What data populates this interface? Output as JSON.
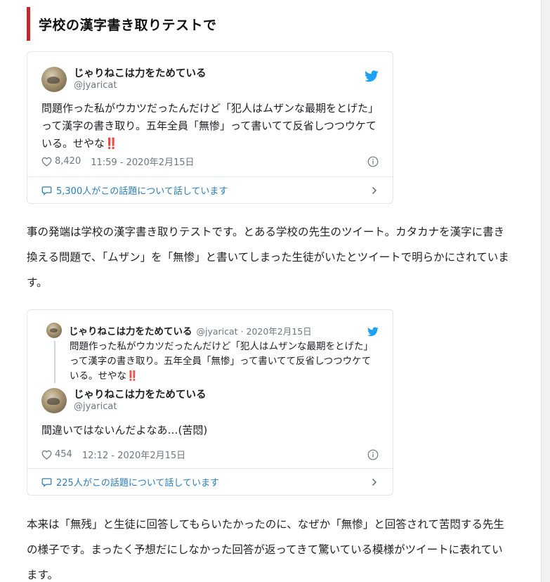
{
  "article": {
    "heading": "学校の漢字書き取りテストで",
    "paragraph1": "事の発端は学校の漢字書き取りテストです。とある学校の先生のツイート。カタカナを漢字に書き換える問題で、「ムザン」を「無惨」と書いてしまった生徒がいたとツイートで明らかにされています。",
    "paragraph2": "本来は「無残」と生徒に回答してもらいたかったのに、なぜか「無惨」と回答されて苦悶する先生の様子です。まったく予想だにしなかった回答が返ってきて驚いている模様がツイートに表れています。"
  },
  "tweet1": {
    "name": "じゃりねこは力をためている",
    "handle": "@jyaricat",
    "text": "問題作った私がウカツだったんだけど「犯人はムザンな最期をとげた」って漢字の書き取り。五年全員「無惨」って書いてて反省しつつウケている。せやな‼️",
    "likes": "8,420",
    "timestamp": "11:59 - 2020年2月15日",
    "replies_label": "5,300人がこの話題について話しています"
  },
  "tweet2": {
    "parent": {
      "name": "じゃりねこは力をためている",
      "handle_date": "@jyaricat · 2020年2月15日",
      "text": "問題作った私がウカツだったんだけど「犯人はムザンな最期をとげた」って漢字の書き取り。五年全員「無惨」って書いてて反省しつつウケている。せやな‼️"
    },
    "name": "じゃりねこは力をためている",
    "handle": "@jyaricat",
    "text": "間違いではないんだよなあ…(苦悶)",
    "likes": "454",
    "timestamp": "12:12 - 2020年2月15日",
    "replies_label": "225人がこの話題について話しています"
  },
  "icons": {
    "bird": "twitter-bird-icon",
    "heart": "heart-icon",
    "info": "info-icon",
    "bubble": "speech-bubble-icon",
    "chevron": "chevron-right-icon"
  },
  "colors": {
    "heading_accent": "#c0292b",
    "twitter_blue": "#1da1f2",
    "link_blue": "#2b7bb9",
    "muted": "#697882"
  }
}
